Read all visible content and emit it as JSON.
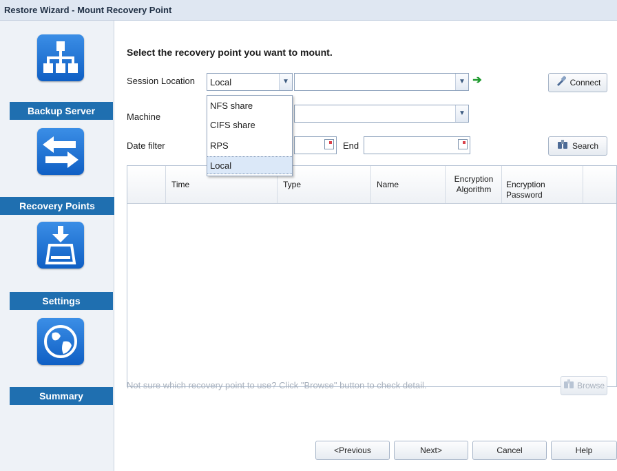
{
  "window": {
    "title": "Restore Wizard - Mount Recovery Point"
  },
  "sidebar": {
    "steps": [
      {
        "label": "Backup Server",
        "icon": "server-network-icon"
      },
      {
        "label": "Recovery Points",
        "icon": "swap-arrows-icon",
        "active": true
      },
      {
        "label": "Settings",
        "icon": "download-drive-icon"
      },
      {
        "label": "Summary",
        "icon": "globe-icon"
      }
    ]
  },
  "main": {
    "heading": "Select the recovery point you want to mount.",
    "session_location": {
      "label": "Session Location",
      "value": "Local",
      "path_value": "",
      "options": [
        "NFS share",
        "CIFS share",
        "RPS",
        "Local"
      ],
      "selected_option": "Local"
    },
    "connect_button": {
      "label": "Connect",
      "icon": "connect-plug-icon"
    },
    "machine": {
      "label": "Machine",
      "value": ""
    },
    "date_filter": {
      "label": "Date filter",
      "start_value": "",
      "end_label": "End",
      "end_value": ""
    },
    "search_button": {
      "label": "Search",
      "icon": "binoculars-icon"
    },
    "table": {
      "columns": [
        "",
        "Time",
        "Type",
        "Name",
        "Encryption Algorithm",
        "Encryption Password"
      ],
      "rows": []
    },
    "hint": "Not sure which recovery point to use? Click \"Browse\" button to check detail.",
    "browse_button": {
      "label": "Browse",
      "icon": "binoculars-icon",
      "disabled": true
    }
  },
  "footer": {
    "previous": "<Previous",
    "next": "Next>",
    "cancel": "Cancel",
    "help": "Help"
  },
  "colors": {
    "accent": "#1f6fb0",
    "title_bar": "#dfe7f2",
    "sidebar_bg": "#eef2f7",
    "go_arrow": "#1e9a2e"
  }
}
